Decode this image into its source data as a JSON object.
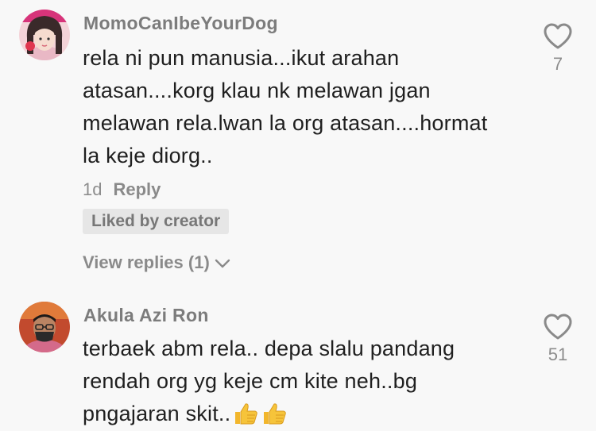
{
  "comments": [
    {
      "username": "MomoCanIbeYourDog",
      "text_lines": [
        "rela ni pun manusia...ikut arahan",
        "atasan....korg klau nk melawan jgan",
        "melawan rela.lwan la org atasan....hormat",
        "la keje diorg.."
      ],
      "time": "1d",
      "reply_label": "Reply",
      "badge": "Liked by creator",
      "view_replies": "View replies (1)",
      "likes": "7",
      "avatar_icon": "user-avatar-girl"
    },
    {
      "username": "Akula Azi Ron",
      "text_lines": [
        "terbaek abm rela.. depa slalu pandang",
        "rendah org yg keje cm kite neh..bg",
        "pngajaran skit.."
      ],
      "emoji": [
        "👍",
        "👍"
      ],
      "likes": "51",
      "avatar_icon": "user-avatar-man"
    }
  ],
  "colors": {
    "background": "#f8f8f8",
    "username": "#7c7c7c",
    "text": "#1f1f1f",
    "meta": "#8d8d8d",
    "badge_bg": "#e6e6e6"
  }
}
